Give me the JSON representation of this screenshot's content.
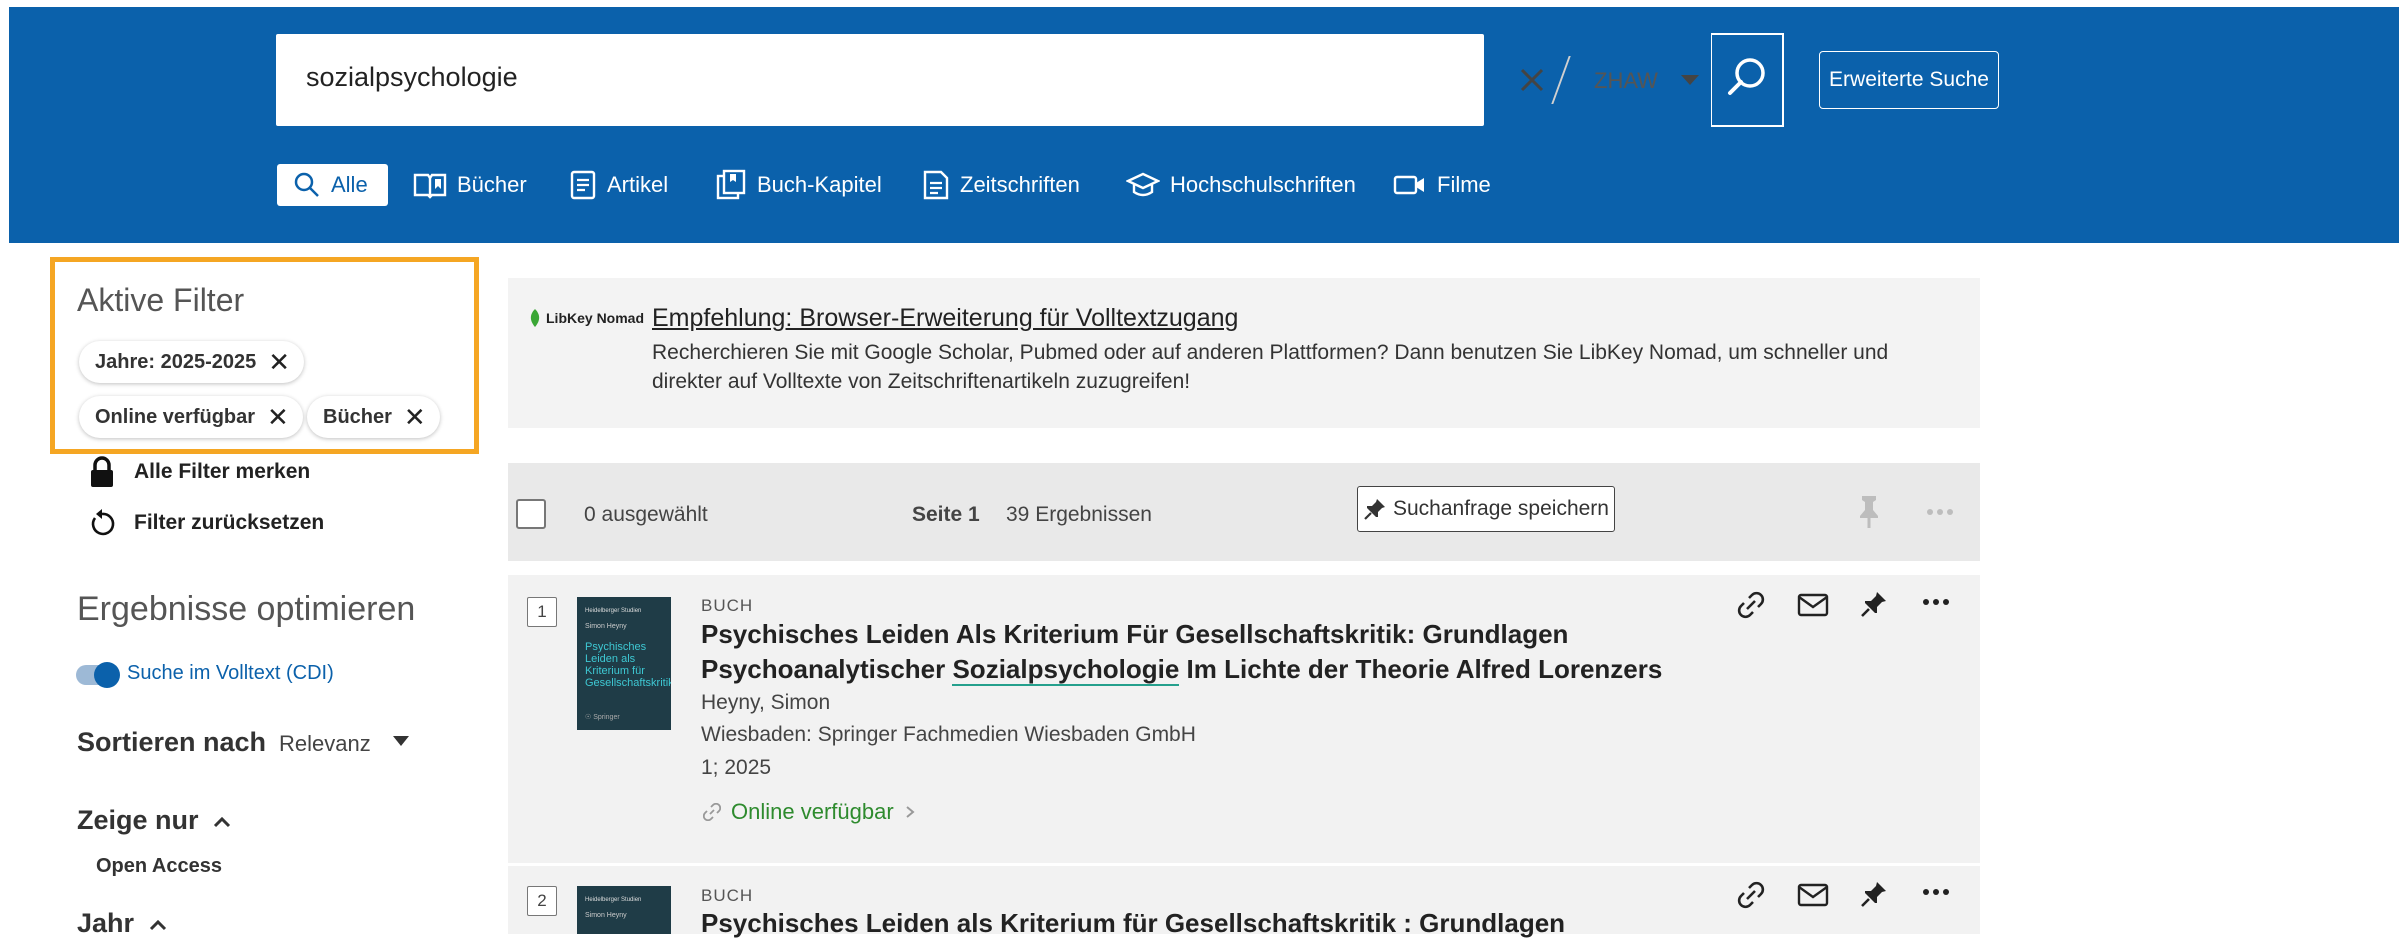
{
  "search": {
    "query": "sozialpsychologie",
    "scope": "ZHAW",
    "advanced_label": "Erweiterte Suche"
  },
  "tabs": [
    {
      "label": "Alle",
      "icon": "search-icon"
    },
    {
      "label": "Bücher",
      "icon": "book-icon"
    },
    {
      "label": "Artikel",
      "icon": "article-icon"
    },
    {
      "label": "Buch-Kapitel",
      "icon": "book-chapter-icon"
    },
    {
      "label": "Zeitschriften",
      "icon": "journal-icon"
    },
    {
      "label": "Hochschulschriften",
      "icon": "graduation-cap-icon"
    },
    {
      "label": "Filme",
      "icon": "video-camera-icon"
    }
  ],
  "sidebar": {
    "active_filters_title": "Aktive Filter",
    "chips": [
      "Jahre: 2025-2025",
      "Online verfügbar",
      "Bücher"
    ],
    "remember_all": "Alle Filter merken",
    "reset_filters": "Filter zurücksetzen",
    "optimize_title": "Ergebnisse optimieren",
    "fulltext_toggle": "Suche im Volltext (CDI)",
    "sort_label": "Sortieren nach",
    "sort_value": "Relevanz",
    "show_only": "Zeige nur",
    "open_access": "Open Access",
    "year": "Jahr"
  },
  "libkey": {
    "logo": "LibKey Nomad",
    "link": "Empfehlung: Browser-Erweiterung für Volltextzugang",
    "desc": "Recherchieren Sie mit Google Scholar, Pubmed oder auf anderen Plattformen? Dann benutzen Sie LibKey Nomad, um schneller und direkter auf Volltexte von Zeitschriftenartikeln zuzugreifen!"
  },
  "results_bar": {
    "selected": "0 ausgewählt",
    "page": "Seite 1",
    "count": "39 Ergebnissen",
    "save_query": "Suchanfrage speichern"
  },
  "results": [
    {
      "num": "1",
      "type": "BUCH",
      "title_line1": "Psychisches Leiden Als Kriterium Für Gesellschaftskritik: Grundlagen",
      "title_line2_pre": "Psychoanalytischer ",
      "title_line2_hl": "Sozialpsychologie",
      "title_line2_post": " Im Lichte der Theorie Alfred Lorenzers",
      "author": "Heyny, Simon",
      "publisher": "Wiesbaden: Springer Fachmedien Wiesbaden GmbH",
      "edition": "1; 2025",
      "availability": "Online verfügbar",
      "cover": {
        "author": "Simon Heyny",
        "title": "Psychisches Leiden als Kriterium für Gesellschaftskritik"
      }
    },
    {
      "num": "2",
      "type": "BUCH",
      "title_line1": "Psychisches Leiden als Kriterium für Gesellschaftskritik : Grundlagen",
      "cover": {
        "author": "Simon Heyny"
      }
    }
  ]
}
